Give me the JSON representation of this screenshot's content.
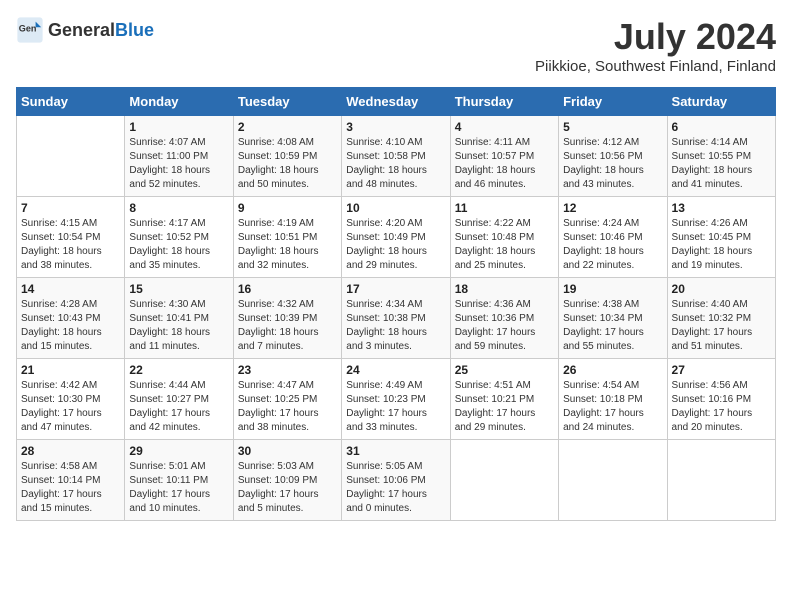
{
  "header": {
    "logo_general": "General",
    "logo_blue": "Blue",
    "month_year": "July 2024",
    "location": "Piikkioe, Southwest Finland, Finland"
  },
  "calendar": {
    "days_of_week": [
      "Sunday",
      "Monday",
      "Tuesday",
      "Wednesday",
      "Thursday",
      "Friday",
      "Saturday"
    ],
    "weeks": [
      [
        {
          "day": "",
          "sunrise": "",
          "sunset": "",
          "daylight": ""
        },
        {
          "day": "1",
          "sunrise": "Sunrise: 4:07 AM",
          "sunset": "Sunset: 11:00 PM",
          "daylight": "Daylight: 18 hours and 52 minutes."
        },
        {
          "day": "2",
          "sunrise": "Sunrise: 4:08 AM",
          "sunset": "Sunset: 10:59 PM",
          "daylight": "Daylight: 18 hours and 50 minutes."
        },
        {
          "day": "3",
          "sunrise": "Sunrise: 4:10 AM",
          "sunset": "Sunset: 10:58 PM",
          "daylight": "Daylight: 18 hours and 48 minutes."
        },
        {
          "day": "4",
          "sunrise": "Sunrise: 4:11 AM",
          "sunset": "Sunset: 10:57 PM",
          "daylight": "Daylight: 18 hours and 46 minutes."
        },
        {
          "day": "5",
          "sunrise": "Sunrise: 4:12 AM",
          "sunset": "Sunset: 10:56 PM",
          "daylight": "Daylight: 18 hours and 43 minutes."
        },
        {
          "day": "6",
          "sunrise": "Sunrise: 4:14 AM",
          "sunset": "Sunset: 10:55 PM",
          "daylight": "Daylight: 18 hours and 41 minutes."
        }
      ],
      [
        {
          "day": "7",
          "sunrise": "Sunrise: 4:15 AM",
          "sunset": "Sunset: 10:54 PM",
          "daylight": "Daylight: 18 hours and 38 minutes."
        },
        {
          "day": "8",
          "sunrise": "Sunrise: 4:17 AM",
          "sunset": "Sunset: 10:52 PM",
          "daylight": "Daylight: 18 hours and 35 minutes."
        },
        {
          "day": "9",
          "sunrise": "Sunrise: 4:19 AM",
          "sunset": "Sunset: 10:51 PM",
          "daylight": "Daylight: 18 hours and 32 minutes."
        },
        {
          "day": "10",
          "sunrise": "Sunrise: 4:20 AM",
          "sunset": "Sunset: 10:49 PM",
          "daylight": "Daylight: 18 hours and 29 minutes."
        },
        {
          "day": "11",
          "sunrise": "Sunrise: 4:22 AM",
          "sunset": "Sunset: 10:48 PM",
          "daylight": "Daylight: 18 hours and 25 minutes."
        },
        {
          "day": "12",
          "sunrise": "Sunrise: 4:24 AM",
          "sunset": "Sunset: 10:46 PM",
          "daylight": "Daylight: 18 hours and 22 minutes."
        },
        {
          "day": "13",
          "sunrise": "Sunrise: 4:26 AM",
          "sunset": "Sunset: 10:45 PM",
          "daylight": "Daylight: 18 hours and 19 minutes."
        }
      ],
      [
        {
          "day": "14",
          "sunrise": "Sunrise: 4:28 AM",
          "sunset": "Sunset: 10:43 PM",
          "daylight": "Daylight: 18 hours and 15 minutes."
        },
        {
          "day": "15",
          "sunrise": "Sunrise: 4:30 AM",
          "sunset": "Sunset: 10:41 PM",
          "daylight": "Daylight: 18 hours and 11 minutes."
        },
        {
          "day": "16",
          "sunrise": "Sunrise: 4:32 AM",
          "sunset": "Sunset: 10:39 PM",
          "daylight": "Daylight: 18 hours and 7 minutes."
        },
        {
          "day": "17",
          "sunrise": "Sunrise: 4:34 AM",
          "sunset": "Sunset: 10:38 PM",
          "daylight": "Daylight: 18 hours and 3 minutes."
        },
        {
          "day": "18",
          "sunrise": "Sunrise: 4:36 AM",
          "sunset": "Sunset: 10:36 PM",
          "daylight": "Daylight: 17 hours and 59 minutes."
        },
        {
          "day": "19",
          "sunrise": "Sunrise: 4:38 AM",
          "sunset": "Sunset: 10:34 PM",
          "daylight": "Daylight: 17 hours and 55 minutes."
        },
        {
          "day": "20",
          "sunrise": "Sunrise: 4:40 AM",
          "sunset": "Sunset: 10:32 PM",
          "daylight": "Daylight: 17 hours and 51 minutes."
        }
      ],
      [
        {
          "day": "21",
          "sunrise": "Sunrise: 4:42 AM",
          "sunset": "Sunset: 10:30 PM",
          "daylight": "Daylight: 17 hours and 47 minutes."
        },
        {
          "day": "22",
          "sunrise": "Sunrise: 4:44 AM",
          "sunset": "Sunset: 10:27 PM",
          "daylight": "Daylight: 17 hours and 42 minutes."
        },
        {
          "day": "23",
          "sunrise": "Sunrise: 4:47 AM",
          "sunset": "Sunset: 10:25 PM",
          "daylight": "Daylight: 17 hours and 38 minutes."
        },
        {
          "day": "24",
          "sunrise": "Sunrise: 4:49 AM",
          "sunset": "Sunset: 10:23 PM",
          "daylight": "Daylight: 17 hours and 33 minutes."
        },
        {
          "day": "25",
          "sunrise": "Sunrise: 4:51 AM",
          "sunset": "Sunset: 10:21 PM",
          "daylight": "Daylight: 17 hours and 29 minutes."
        },
        {
          "day": "26",
          "sunrise": "Sunrise: 4:54 AM",
          "sunset": "Sunset: 10:18 PM",
          "daylight": "Daylight: 17 hours and 24 minutes."
        },
        {
          "day": "27",
          "sunrise": "Sunrise: 4:56 AM",
          "sunset": "Sunset: 10:16 PM",
          "daylight": "Daylight: 17 hours and 20 minutes."
        }
      ],
      [
        {
          "day": "28",
          "sunrise": "Sunrise: 4:58 AM",
          "sunset": "Sunset: 10:14 PM",
          "daylight": "Daylight: 17 hours and 15 minutes."
        },
        {
          "day": "29",
          "sunrise": "Sunrise: 5:01 AM",
          "sunset": "Sunset: 10:11 PM",
          "daylight": "Daylight: 17 hours and 10 minutes."
        },
        {
          "day": "30",
          "sunrise": "Sunrise: 5:03 AM",
          "sunset": "Sunset: 10:09 PM",
          "daylight": "Daylight: 17 hours and 5 minutes."
        },
        {
          "day": "31",
          "sunrise": "Sunrise: 5:05 AM",
          "sunset": "Sunset: 10:06 PM",
          "daylight": "Daylight: 17 hours and 0 minutes."
        },
        {
          "day": "",
          "sunrise": "",
          "sunset": "",
          "daylight": ""
        },
        {
          "day": "",
          "sunrise": "",
          "sunset": "",
          "daylight": ""
        },
        {
          "day": "",
          "sunrise": "",
          "sunset": "",
          "daylight": ""
        }
      ]
    ]
  }
}
